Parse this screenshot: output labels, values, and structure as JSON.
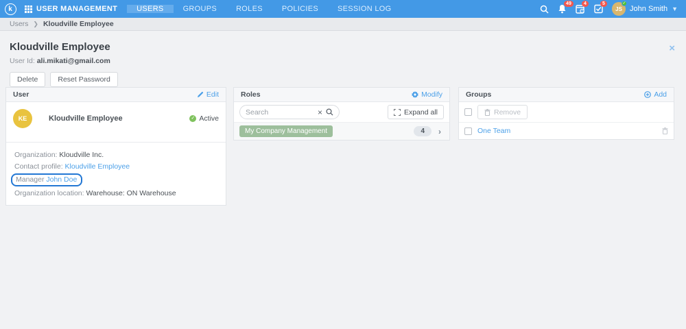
{
  "navbar": {
    "logo_letter": "k",
    "app_title": "USER MANAGEMENT",
    "items": [
      {
        "label": "USERS",
        "active": true
      },
      {
        "label": "GROUPS",
        "active": false
      },
      {
        "label": "ROLES",
        "active": false
      },
      {
        "label": "POLICIES",
        "active": false
      },
      {
        "label": "SESSION LOG",
        "active": false
      }
    ],
    "notifications": {
      "bell": "49",
      "calendar": "4",
      "tasks": "5"
    },
    "user": {
      "initials": "JS",
      "name": "John Smith"
    }
  },
  "breadcrumb": {
    "root": "Users",
    "current": "Kloudville Employee"
  },
  "page": {
    "title": "Kloudville Employee",
    "user_id_label": "User Id:",
    "user_id_value": "ali.mikati@gmail.com",
    "delete_label": "Delete",
    "reset_password_label": "Reset Password",
    "close_glyph": "×"
  },
  "user_card": {
    "title": "User",
    "edit_label": "Edit",
    "avatar_initials": "KE",
    "name": "Kloudville Employee",
    "status": "Active",
    "details": [
      {
        "label": "Organization:",
        "value": "Kloudville Inc."
      },
      {
        "label": "Contact profile:",
        "value": "Kloudville Employee"
      },
      {
        "label": "Manager",
        "value": "John Doe"
      },
      {
        "label": "Organization location:",
        "value": "Warehouse: ON Warehouse"
      }
    ]
  },
  "roles_card": {
    "title": "Roles",
    "modify_label": "Modify",
    "search_placeholder": "Search",
    "clear_glyph": "×",
    "expand_all_label": "Expand all",
    "roles": [
      {
        "name": "My Company Management",
        "count": "4",
        "chevron": "›"
      }
    ]
  },
  "groups_card": {
    "title": "Groups",
    "add_label": "Add",
    "remove_label": "Remove",
    "groups": [
      {
        "name": "One Team"
      }
    ]
  },
  "colors": {
    "navbar_blue": "#4399e6",
    "active_tab_blue": "#65acec",
    "accent_blue": "#4ca0e8",
    "highlight_border_blue": "#2277d4",
    "badge_red": "#f4574d",
    "avatar_gold": "#e9c33f",
    "status_green": "#7fc25d",
    "tag_green": "#9dbf9c",
    "user_avatar_tan": "#d8b66e",
    "page_bg": "#f1f2f4"
  }
}
